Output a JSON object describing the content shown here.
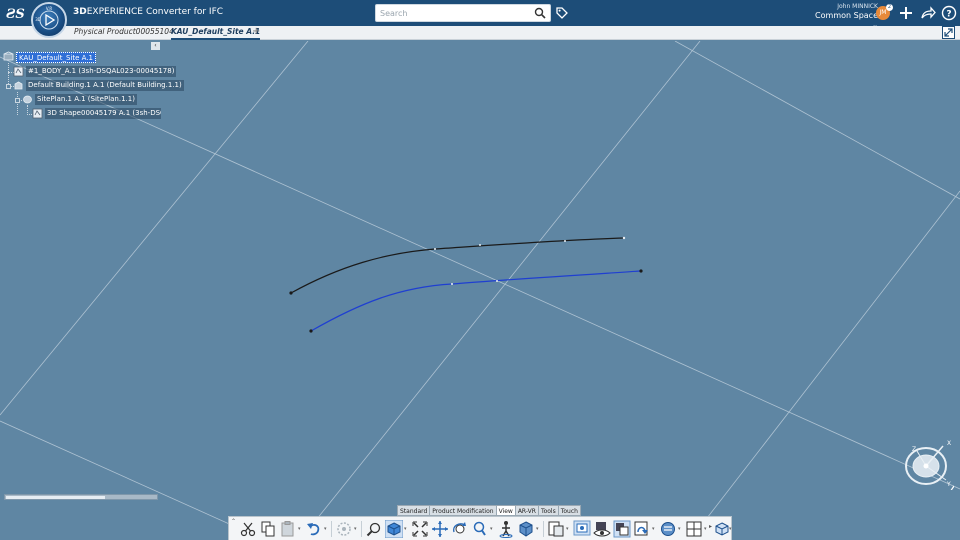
{
  "header": {
    "brand_bold": "3D",
    "brand_light": "EXPERIENCE",
    "app_name": "Converter for IFC",
    "compass_label": "V.R",
    "compass_sub": "3D",
    "search_placeholder": "Search",
    "user_name": "John MINNICK",
    "space_name": "Common Space",
    "avatar_initials": "JM",
    "notif_count": "2"
  },
  "tabs": [
    {
      "label": "Physical Product00055104",
      "active": false
    },
    {
      "label": "KAU_Default_Site A.1",
      "active": true
    }
  ],
  "tab_add": "+",
  "tree": {
    "collapse": "‹",
    "nodes": [
      {
        "label": "KAU_Default_Site A.1",
        "selected": true
      },
      {
        "label": "#1_BODY_A.1 (3sh-DSQAL023-00045178)",
        "selected": false
      },
      {
        "label": "Default Building.1 A.1 (Default Building.1.1)",
        "selected": false
      },
      {
        "label": "SitePlan.1 A.1 (SitePlan.1.1)",
        "selected": false
      },
      {
        "label": "3D Shape00045179 A.1 (3sh-DSQAL",
        "selected": false
      }
    ]
  },
  "compass": {
    "x": "X",
    "y": "Y",
    "z": "Z"
  },
  "scroll_fraction": 0.66,
  "actionbar": {
    "tabs": [
      {
        "label": "Standard",
        "active": false
      },
      {
        "label": "Product Modification",
        "active": false
      },
      {
        "label": "View",
        "active": true
      },
      {
        "label": "AR-VR",
        "active": false
      },
      {
        "label": "Tools",
        "active": false
      },
      {
        "label": "Touch",
        "active": false
      }
    ]
  },
  "colors": {
    "topbar": "#1d4d78",
    "viewport": "#5f86a3",
    "curve_black": "#1a1a1a",
    "curve_blue": "#1f3fd1"
  }
}
